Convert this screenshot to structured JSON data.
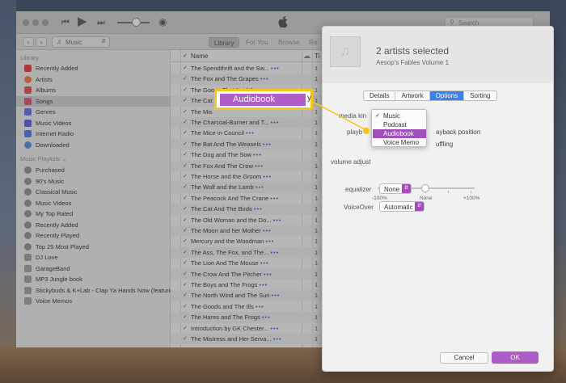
{
  "window": {
    "search_placeholder": "Search",
    "media_picker": "Music",
    "tabs": [
      "Library",
      "For You",
      "Browse",
      "Ra"
    ]
  },
  "sidebar": {
    "library_header": "Library",
    "library_items": [
      {
        "label": "Recently Added",
        "color": "#d63b3b"
      },
      {
        "label": "Artists",
        "color": "#e8763a"
      },
      {
        "label": "Albums",
        "color": "#d75050"
      },
      {
        "label": "Songs",
        "color": "#d94a6a"
      },
      {
        "label": "Genres",
        "color": "#6a6ad8"
      },
      {
        "label": "Music Videos",
        "color": "#5a5ad0"
      },
      {
        "label": "Internet Radio",
        "color": "#4a7ad8"
      },
      {
        "label": "Downloaded",
        "color": "#4a8ad8"
      }
    ],
    "playlists_header": "Music Playlists ⌄",
    "playlist_items": [
      {
        "label": "Purchased",
        "icon": "gear"
      },
      {
        "label": "90's Music",
        "icon": "gear"
      },
      {
        "label": "Classical Music",
        "icon": "gear"
      },
      {
        "label": "Music Videos",
        "icon": "gear"
      },
      {
        "label": "My Top Rated",
        "icon": "gear"
      },
      {
        "label": "Recently Added",
        "icon": "gear"
      },
      {
        "label": "Recently Played",
        "icon": "gear"
      },
      {
        "label": "Top 25 Most Played",
        "icon": "gear"
      },
      {
        "label": "DJ Love",
        "icon": "list"
      },
      {
        "label": "GarageBand",
        "icon": "list"
      },
      {
        "label": "MP3 Jungle book",
        "icon": "list"
      },
      {
        "label": "Stickybuds & K+Lab - Clap Ya Hands Now (featuring ...",
        "icon": "list"
      },
      {
        "label": "Voice Memos",
        "icon": "list"
      }
    ]
  },
  "songlist": {
    "header_name": "Name",
    "header_col": "Ti",
    "cloud_icon": "cloud-icon",
    "songs": [
      {
        "name": "The Spendthrift and the Sw...",
        "more": "•••",
        "num": "1"
      },
      {
        "name": "The Fox and The Grapes",
        "more": "•••",
        "num": "1"
      },
      {
        "name": "The Goose That Laid the",
        "more": "",
        "num": "1"
      },
      {
        "name": "The Cat",
        "more": "",
        "num": "1"
      },
      {
        "name": "The Mis",
        "more": "",
        "num": "1"
      },
      {
        "name": "The Charcoal-Burner and T...",
        "more": "•••",
        "num": "1"
      },
      {
        "name": "The Mice in Council",
        "more": "•••",
        "num": "1"
      },
      {
        "name": "The Bat And The Weasels",
        "more": "•••",
        "num": "1"
      },
      {
        "name": "The Dog and The Sow",
        "more": "•••",
        "num": "1"
      },
      {
        "name": "The Fox And The Crow",
        "more": "•••",
        "num": "1"
      },
      {
        "name": "The Horse and the Groom",
        "more": "•••",
        "num": "1"
      },
      {
        "name": "The Wolf and the Lamb",
        "more": "•••",
        "num": "1"
      },
      {
        "name": "The Peacock And The Crane",
        "more": "•••",
        "num": "1"
      },
      {
        "name": "The Cat And The Birds",
        "more": "•••",
        "num": "1"
      },
      {
        "name": "The Old Woman and the Do...",
        "more": "•••",
        "num": "1"
      },
      {
        "name": "The Moon and her Mother",
        "more": "•••",
        "num": "1"
      },
      {
        "name": "Mercury and the Woodman",
        "more": "•••",
        "num": "1"
      },
      {
        "name": "The Ass, The Fox, and The...",
        "more": "•••",
        "num": "1"
      },
      {
        "name": "The Lion And The Mouse",
        "more": "•••",
        "num": "1"
      },
      {
        "name": "The Crow And The Pitcher",
        "more": "•••",
        "num": "1"
      },
      {
        "name": "The Boys and The Frogs",
        "more": "•••",
        "num": "1"
      },
      {
        "name": "The North Wind and The Sun",
        "more": "•••",
        "num": "1"
      },
      {
        "name": "The Goods and The Ills",
        "more": "•••",
        "num": "1"
      },
      {
        "name": "The Hares and The Frogs",
        "more": "•••",
        "num": "1"
      },
      {
        "name": "Introduction by GK Chester...",
        "more": "•••",
        "num": "1"
      },
      {
        "name": "The Mistress and Her Serva...",
        "more": "•••",
        "num": "1"
      }
    ]
  },
  "dialog": {
    "title": "2 artists selected",
    "subtitle": "Aesop's Fables Volume 1",
    "tabs": [
      "Details",
      "Artwork",
      "Options",
      "Sorting"
    ],
    "active_tab": "Options",
    "media_kind_label": "media kin",
    "playback_label": "playb",
    "playback_text": "ayback position",
    "shuffle_text": "uffling",
    "volume_label": "volume adjust",
    "volume_min": "-100%",
    "volume_mid": "None",
    "volume_max": "+100%",
    "volume_level": 0.5,
    "equalizer_label": "equalizer",
    "equalizer_value": "None",
    "voiceover_label": "VoiceOver",
    "voiceover_value": "Automatic",
    "media_options": [
      "Music",
      "Podcast",
      "Audiobook",
      "Voice Memo"
    ],
    "media_checked": "Music",
    "media_highlighted": "Audiobook",
    "cancel_label": "Cancel",
    "ok_label": "OK"
  },
  "callout": {
    "label": "Audiobook",
    "trailing": "y"
  },
  "colors": {
    "accent_purple": "#b25ec9",
    "callout_yellow": "#f5c518",
    "tab_blue": "#3f7fe6"
  }
}
